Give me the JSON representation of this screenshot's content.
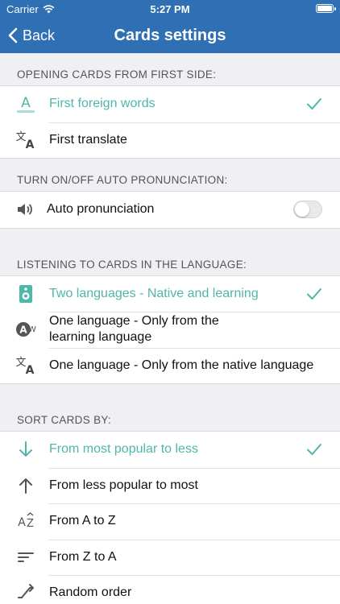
{
  "status": {
    "carrier": "Carrier",
    "time": "5:27 PM"
  },
  "nav": {
    "back_label": "Back",
    "title": "Cards settings"
  },
  "accent_color": "#4fb7a9",
  "nav_color": "#2f6fb3",
  "sections": {
    "opening": {
      "header": "OPENING CARDS FROM FIRST SIDE:",
      "items": [
        {
          "label": "First foreign words",
          "icon": "text-a-icon",
          "selected": true
        },
        {
          "label": "First translate",
          "icon": "translate-icon",
          "selected": false
        }
      ]
    },
    "auto": {
      "header": "TURN ON/OFF AUTO PRONUNCIATION:",
      "items": [
        {
          "label": "Auto pronunciation",
          "icon": "speaker-icon",
          "toggle": false
        }
      ]
    },
    "listening": {
      "header": "LISTENING TO CARDS IN THE LANGUAGE:",
      "items": [
        {
          "label": "Two languages - Native and learning",
          "icon": "audio-device-icon",
          "selected": true
        },
        {
          "label": "One language - Only from the learning language",
          "icon": "aw-language-icon",
          "selected": false
        },
        {
          "label": "One language - Only from the native language",
          "icon": "translate-icon",
          "selected": false
        }
      ]
    },
    "sort": {
      "header": "SORT CARDS BY:",
      "items": [
        {
          "label": "From most popular to less",
          "icon": "arrow-down-icon",
          "selected": true
        },
        {
          "label": "From less popular to most",
          "icon": "arrow-up-icon",
          "selected": false
        },
        {
          "label": "From A to Z",
          "icon": "sort-az-icon",
          "selected": false
        },
        {
          "label": "From Z to A",
          "icon": "sort-lines-icon",
          "selected": false
        },
        {
          "label": "Random order",
          "icon": "shuffle-icon",
          "selected": false
        }
      ]
    }
  }
}
